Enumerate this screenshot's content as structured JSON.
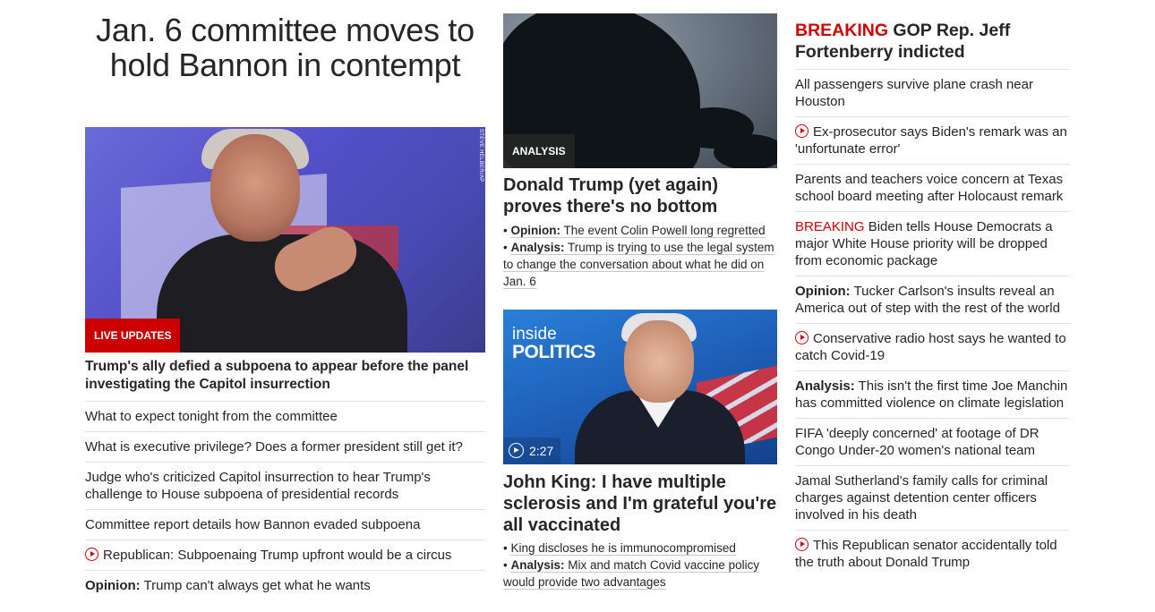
{
  "col1": {
    "headline": "Jan. 6 committee moves to hold Bannon in contempt",
    "photo_credit": "STEVE HELBER/AP",
    "badge": "LIVE UPDATES",
    "lead": "Trump's ally defied a subpoena to appear before the panel investigating the Capitol insurrection",
    "items": [
      {
        "prefix": "",
        "text": "What to expect tonight from the committee",
        "video": false
      },
      {
        "prefix": "",
        "text": "What is executive privilege? Does a former president still get it?",
        "video": false
      },
      {
        "prefix": "",
        "text": "Judge who's criticized Capitol insurrection to hear Trump's challenge to House subpoena of presidential records",
        "video": false
      },
      {
        "prefix": "",
        "text": "Committee report details how Bannon evaded subpoena",
        "video": false
      },
      {
        "prefix": "",
        "text": "Republican: Subpoenaing Trump upfront would be a circus",
        "video": true
      },
      {
        "prefix": "Opinion:",
        "text": " Trump can't always get what he wants",
        "video": false
      }
    ]
  },
  "col2": {
    "story1": {
      "badge": "ANALYSIS",
      "headline": "Donald Trump (yet again) proves there's no bottom",
      "sub1_label": "Opinion:",
      "sub1_text": "The event Colin Powell long regretted",
      "sub2_label": "Analysis:",
      "sub2_text": "Trump is trying to use the legal system to change the conversation about what he did on Jan. 6"
    },
    "story2": {
      "logo_line1": "inside",
      "logo_line2": "POLITICS",
      "duration": "2:27",
      "headline": "John King: I have multiple sclerosis and I'm grateful you're all vaccinated",
      "sub1_text": "King discloses he is immunocompromised",
      "sub2_label": "Analysis:",
      "sub2_text": "Mix and match Covid vaccine policy would provide two advantages"
    }
  },
  "col3": {
    "breaking_label": "BREAKING",
    "breaking_text": " GOP Rep. Jeff Fortenberry indicted",
    "items": [
      {
        "prefix": "",
        "text": "All passengers survive plane crash near Houston",
        "video": false,
        "breaking": false
      },
      {
        "prefix": "",
        "text": "Ex-prosecutor says Biden's remark was an 'unfortunate error'",
        "video": true,
        "breaking": false
      },
      {
        "prefix": "",
        "text": "Parents and teachers voice concern at Texas school board meeting after Holocaust remark",
        "video": false,
        "breaking": false
      },
      {
        "prefix": "BREAKING",
        "text": " Biden tells House Democrats a major White House priority will be dropped from economic package",
        "video": false,
        "breaking": true
      },
      {
        "prefix": "Opinion:",
        "text": " Tucker Carlson's insults reveal an America out of step with the rest of the world",
        "video": false,
        "breaking": false
      },
      {
        "prefix": "",
        "text": "Conservative radio host says he wanted to catch Covid-19",
        "video": true,
        "breaking": false
      },
      {
        "prefix": "Analysis:",
        "text": " This isn't the first time Joe Manchin has committed violence on climate legislation",
        "video": false,
        "breaking": false
      },
      {
        "prefix": "",
        "text": "FIFA 'deeply concerned' at footage of DR Congo Under-20 women's national team",
        "video": false,
        "breaking": false
      },
      {
        "prefix": "",
        "text": "Jamal Sutherland's family calls for criminal charges against detention center officers involved in his death",
        "video": false,
        "breaking": false
      },
      {
        "prefix": "",
        "text": "This Republican senator accidentally told the truth about Donald Trump",
        "video": true,
        "breaking": false
      }
    ]
  },
  "colors": {
    "accent_red": "#cc0000",
    "text": "#262626",
    "divider": "#e1e1e1"
  }
}
